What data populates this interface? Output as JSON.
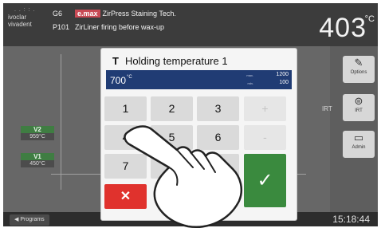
{
  "header": {
    "logo_line1": "ivoclar",
    "logo_line2": "vivadent",
    "logo_dots": ". . : : .",
    "prog_code": "G6",
    "brand": "e.max",
    "title": "ZirPress Staining Tech.",
    "prog_number": "P101",
    "subtitle": "ZirLiner firing before wax-up",
    "temperature": "403",
    "temperature_unit": "°C"
  },
  "chart": {
    "v2_label": "V2",
    "v2_value": "959°C",
    "v1_label": "V1",
    "v1_value": "450°C"
  },
  "sidebar": {
    "options_label": "Options",
    "irt_label": "IRT",
    "irt_button_label": "IRT",
    "admin_label": "Admin"
  },
  "footer": {
    "programs_label": "Programs",
    "clock": "15:18:44"
  },
  "dialog": {
    "title_prefix": "T",
    "title": "Holding temperature 1",
    "current_value": "700",
    "current_unit": "°C",
    "max_tag": "max.",
    "max_value": "1200",
    "min_tag": "min.",
    "min_value": "100"
  },
  "keypad": {
    "k1": "1",
    "k2": "2",
    "k3": "3",
    "plus": "+",
    "k4": "4",
    "k5": "5",
    "k6": "6",
    "minus": "-",
    "k7": "7",
    "k8": "8",
    "k9": "9",
    "cancel": "✕",
    "ok": "✓"
  },
  "colors": {
    "accent_blue": "#203c74",
    "cancel_red": "#e0322d",
    "ok_green": "#3a8a3e",
    "brand_red": "#c94a55"
  }
}
